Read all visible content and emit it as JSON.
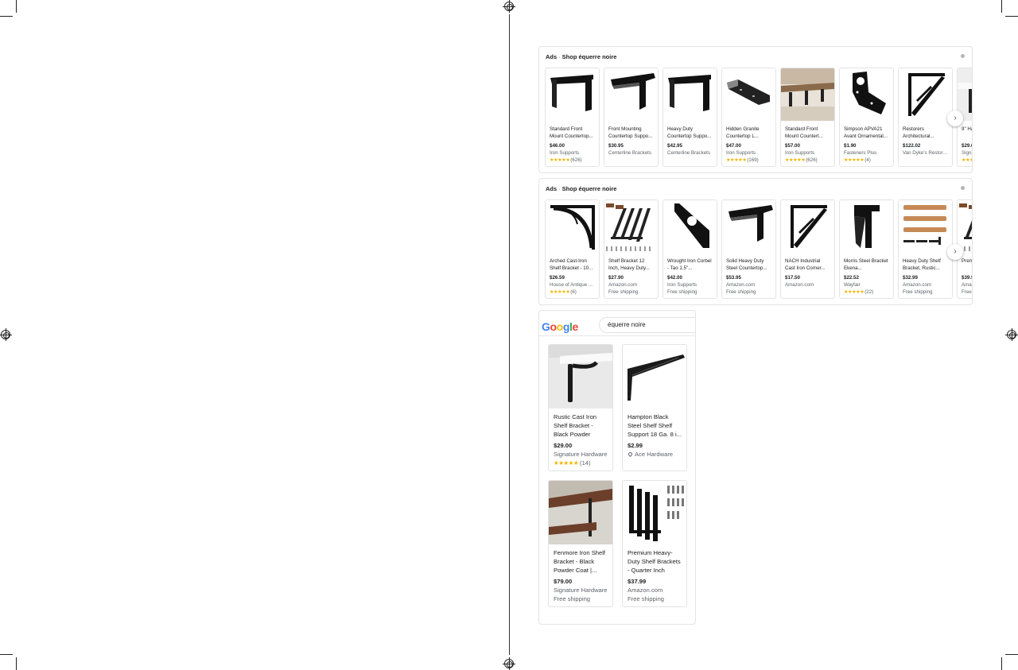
{
  "ad_panels": [
    {
      "ads_label": "Ads",
      "heading": "Shop équerre noire",
      "next_label": "›",
      "products": [
        {
          "title": "Standard Front Mount Countertop...",
          "price": "$46.00",
          "seller": "Iron Supports",
          "stars": "★★★★★",
          "reviews": "(626)",
          "shipping": "",
          "image": "l-bracket-black"
        },
        {
          "title": "Front Mounting Countertop Suppo...",
          "price": "$30.95",
          "seller": "Centerline Brackets",
          "stars": "",
          "reviews": "",
          "shipping": "",
          "image": "l-bracket-wide"
        },
        {
          "title": "Heavy Duty Countertop Suppo...",
          "price": "$42.95",
          "seller": "Centerline Brackets",
          "stars": "",
          "reviews": "",
          "shipping": "",
          "image": "l-bracket-black"
        },
        {
          "title": "Hidden Granite Countertop L...",
          "price": "$47.00",
          "seller": "Iron Supports",
          "stars": "★★★★★",
          "reviews": "(169)",
          "shipping": "",
          "image": "flat-bracket"
        },
        {
          "title": "Standard Front Mount Countert...",
          "price": "$57.00",
          "seller": "Iron Supports",
          "stars": "★★★★★",
          "reviews": "(626)",
          "shipping": "",
          "image": "countertop-photo"
        },
        {
          "title": "Simpson APVA21 Avant Ornamental...",
          "price": "$1.90",
          "seller": "Fasteners Plus",
          "stars": "★★★★★",
          "reviews": "(4)",
          "shipping": "",
          "image": "angle-plate"
        },
        {
          "title": "Restorers Architectural...",
          "price": "$122.02",
          "seller": "Van Dyke's Restore...",
          "stars": "",
          "reviews": "",
          "shipping": "",
          "image": "truss-bracket"
        },
        {
          "title": "9\" Hang... Iron S...",
          "price": "$29.0",
          "seller": "Signat...",
          "stars": "★★★",
          "reviews": "",
          "shipping": "",
          "image": "shelf-white"
        }
      ]
    },
    {
      "ads_label": "Ads",
      "heading": "Shop équerre noire",
      "next_label": "›",
      "products": [
        {
          "title": "Arched Cast-Iron Shelf Bracket - 10...",
          "price": "$26.59",
          "seller": "House of Antique ...",
          "stars": "★★★★★",
          "reviews": "(6)",
          "shipping": "",
          "image": "arched-bracket"
        },
        {
          "title": "Shelf Bracket 12 Inch, Heavy Duty...",
          "price": "$27.90",
          "seller": "Amazon.com",
          "stars": "",
          "reviews": "",
          "shipping": "Free shipping",
          "image": "bracket-set"
        },
        {
          "title": "Wrought Iron Corbel - Tao 1.5\"...",
          "price": "$42.00",
          "seller": "Iron Supports",
          "stars": "",
          "reviews": "",
          "shipping": "Free shipping",
          "image": "corbel"
        },
        {
          "title": "Solid Heavy Duty Steel Countertop...",
          "price": "$53.95",
          "seller": "Amazon.com",
          "stars": "",
          "reviews": "",
          "shipping": "Free shipping",
          "image": "l-bracket-wide"
        },
        {
          "title": "NACH Industrial Cast Iron Corner...",
          "price": "$17.50",
          "seller": "Amazon.com",
          "stars": "",
          "reviews": "",
          "shipping": "",
          "image": "truss-bracket"
        },
        {
          "title": "Morris Steel Bracket Ekena...",
          "price": "$22.52",
          "seller": "Wayfair",
          "stars": "★★★★★",
          "reviews": "(22)",
          "shipping": "",
          "image": "morris-bracket"
        },
        {
          "title": "Heavy Duty Shelf Bracket, Rustic...",
          "price": "$32.99",
          "seller": "Amazon.com",
          "stars": "",
          "reviews": "",
          "shipping": "Free shipping",
          "image": "wood-shelves"
        },
        {
          "title": "Prem... Duty S...",
          "price": "$39.9",
          "seller": "Amaz...",
          "stars": "",
          "reviews": "",
          "shipping": "Free...",
          "image": "bracket-set"
        }
      ]
    }
  ],
  "google_panel": {
    "logo": [
      "G",
      "o",
      "o",
      "g",
      "l",
      "e"
    ],
    "logo_colors": [
      "#4285F4",
      "#EA4335",
      "#FBBC05",
      "#4285F4",
      "#34A853",
      "#EA4335"
    ],
    "search_value": "équerre noire",
    "products": [
      {
        "title": "Rustic Cast Iron Shelf Bracket - Black Powder Coa...",
        "price": "$29.00",
        "seller": "Signature Hardware",
        "stars": "★★★★★",
        "reviews": "(14)",
        "shipping": "",
        "image": "rustic-bracket"
      },
      {
        "title": "Hampton Black Steel Shelf Shelf Support 18 Ga. 8 i...",
        "price": "$2.99",
        "seller": "Ace Hardware",
        "stars": "",
        "reviews": "",
        "shipping": "",
        "image": "hampton-bracket"
      },
      {
        "title": "Fenmore Iron Shelf Bracket - Black Powder Coat |...",
        "price": "$79.00",
        "seller": "Signature Hardware",
        "stars": "",
        "reviews": "",
        "shipping": "Free shipping",
        "image": "fenmore-bracket"
      },
      {
        "title": "Premium Heavy-Duty Shelf Brackets - Quarter Inch (1/4...",
        "price": "$37.99",
        "seller": "Amazon.com",
        "stars": "",
        "reviews": "",
        "shipping": "Free shipping",
        "image": "premium-set"
      }
    ]
  },
  "colors": {
    "star": "#f4b400",
    "text": "#202124",
    "muted": "#5f6368",
    "border": "#e3e3e3"
  }
}
